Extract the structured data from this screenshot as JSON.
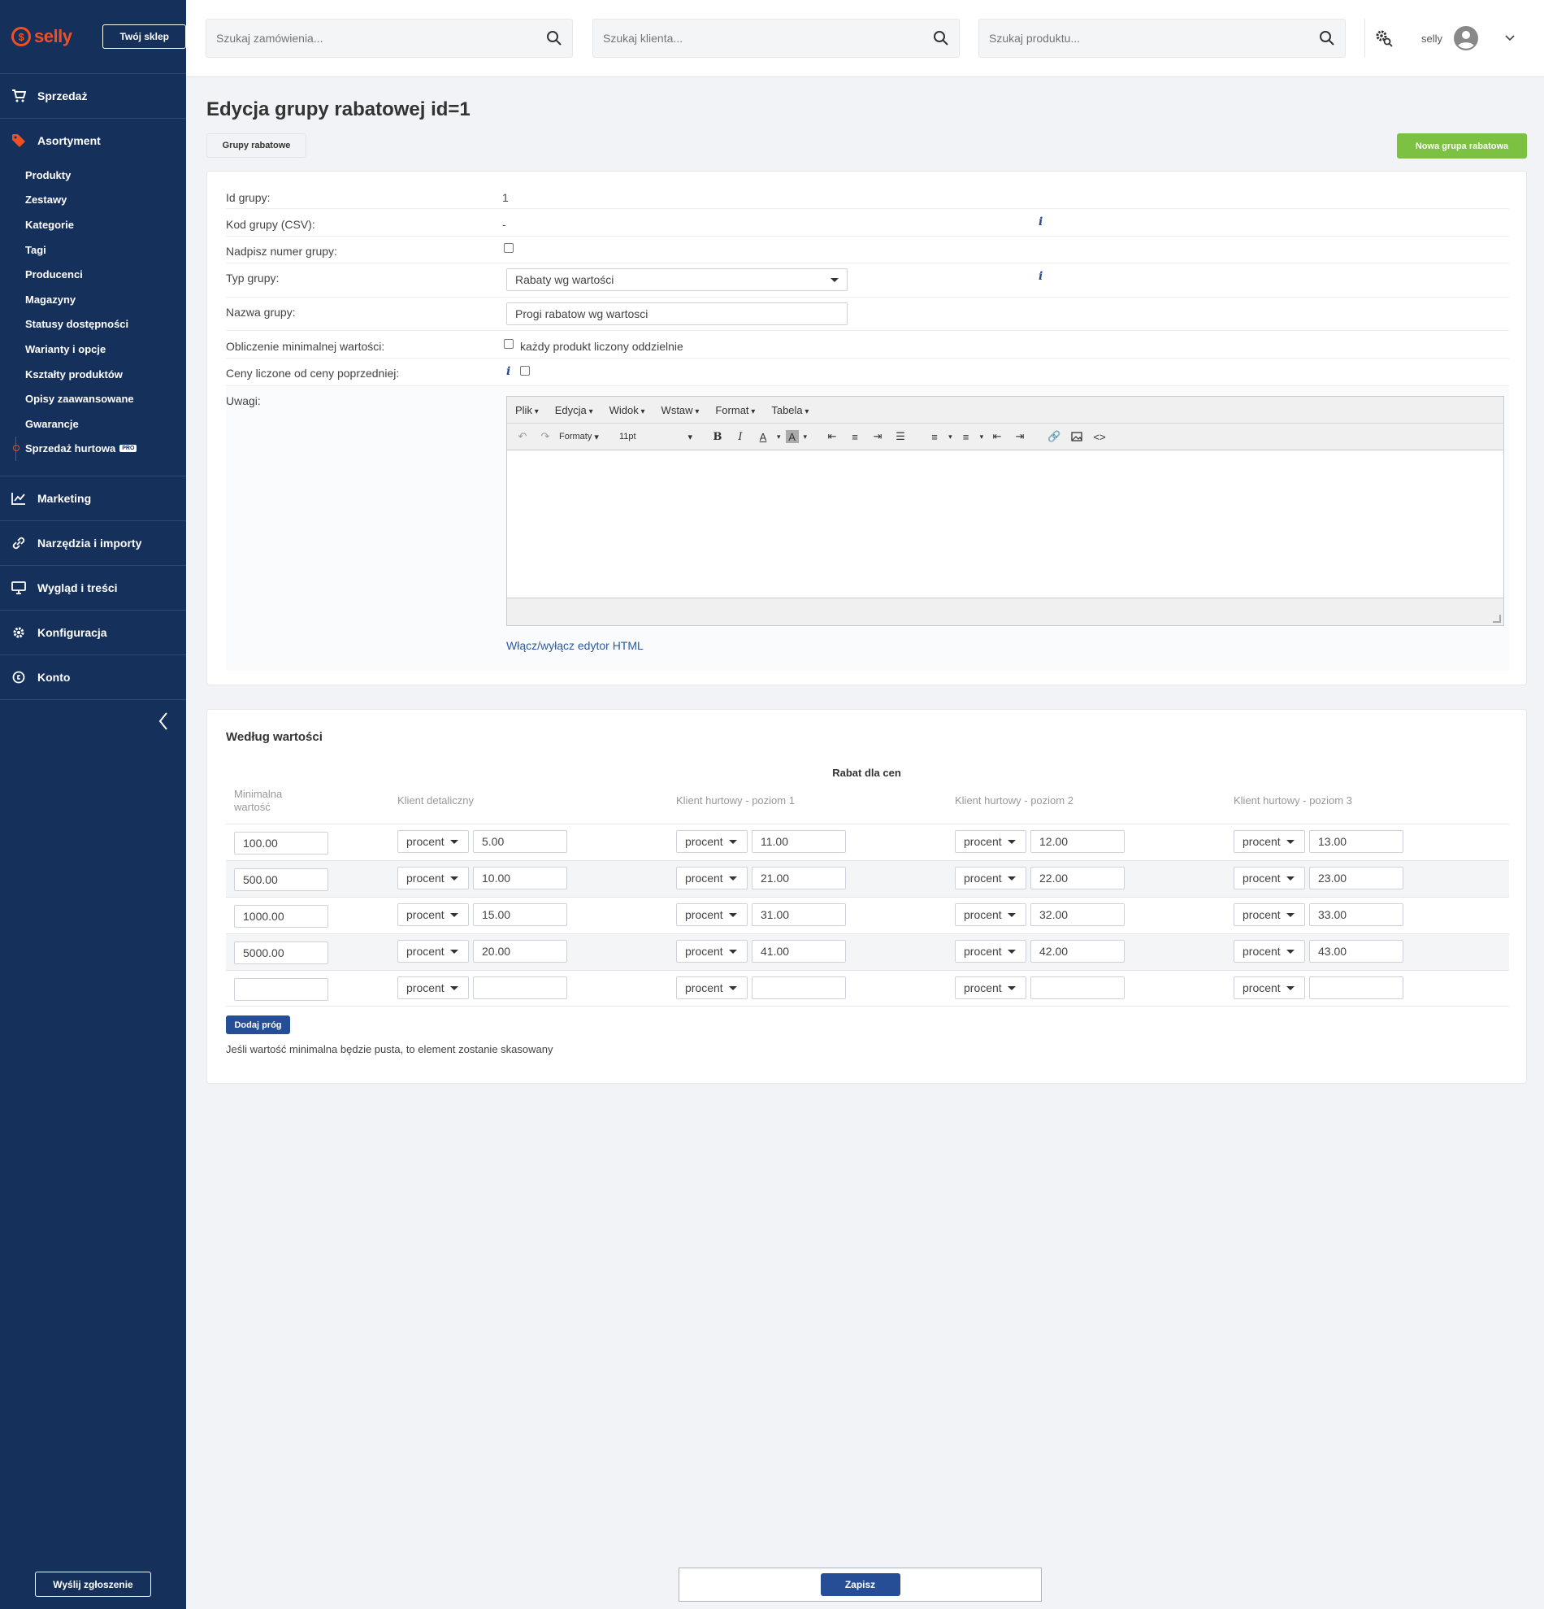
{
  "brand": {
    "logo_text": "selly",
    "shop_button": "Twój sklep"
  },
  "sidebar": {
    "sections": [
      {
        "label": "Sprzedaż",
        "icon": "cart-icon"
      },
      {
        "label": "Asortyment",
        "icon": "tag-icon"
      },
      {
        "label": "Marketing",
        "icon": "chart-icon"
      },
      {
        "label": "Narzędzia i importy",
        "icon": "link-icon"
      },
      {
        "label": "Wygląd i treści",
        "icon": "monitor-icon"
      },
      {
        "label": "Konfiguracja",
        "icon": "gear-icon"
      },
      {
        "label": "Konto",
        "icon": "account-icon"
      }
    ],
    "sub_items": [
      "Produkty",
      "Zestawy",
      "Kategorie",
      "Tagi",
      "Producenci",
      "Magazyny",
      "Statusy dostępności",
      "Warianty i opcje",
      "Kształty produktów",
      "Opisy zaawansowane",
      "Gwarancje",
      "Sprzedaż hurtowa"
    ],
    "pro_badge": "PRO",
    "report_button": "Wyślij zgłoszenie"
  },
  "topbar": {
    "search_orders": "Szukaj zamówienia...",
    "search_clients": "Szukaj klienta...",
    "search_products": "Szukaj produktu...",
    "user_name": "selly"
  },
  "page": {
    "title": "Edycja grupy rabatowej id=1",
    "tab_label": "Grupy rabatowe",
    "new_button": "Nowa grupa rabatowa"
  },
  "form": {
    "id_label": "Id grupy:",
    "id_value": "1",
    "csv_label": "Kod grupy (CSV):",
    "csv_value": "-",
    "overwrite_label": "Nadpisz numer grupy:",
    "type_label": "Typ grupy:",
    "type_value": "Rabaty wg wartości",
    "name_label": "Nazwa grupy:",
    "name_value": "Progi rabatow wg wartosci",
    "min_calc_label": "Obliczenie minimalnej wartości:",
    "min_calc_option": "każdy produkt liczony oddzielnie",
    "prev_price_label": "Ceny liczone od ceny poprzedniej:",
    "notes_label": "Uwagi:",
    "html_toggle": "Włącz/wyłącz edytor HTML"
  },
  "editor": {
    "menus": [
      "Plik",
      "Edycja",
      "Widok",
      "Wstaw",
      "Format",
      "Tabela"
    ],
    "formats_label": "Formaty",
    "font_size": "11pt"
  },
  "thresholds": {
    "title": "Według wartości",
    "group_header": "Rabat dla cen",
    "col_min": "Minimalna wartość",
    "columns": [
      "Klient detaliczny",
      "Klient hurtowy - poziom 1",
      "Klient hurtowy - poziom 2",
      "Klient hurtowy - poziom 3"
    ],
    "type_option": "procent",
    "rows": [
      {
        "min": "100.00",
        "values": [
          "5.00",
          "11.00",
          "12.00",
          "13.00"
        ]
      },
      {
        "min": "500.00",
        "values": [
          "10.00",
          "21.00",
          "22.00",
          "23.00"
        ]
      },
      {
        "min": "1000.00",
        "values": [
          "15.00",
          "31.00",
          "32.00",
          "33.00"
        ]
      },
      {
        "min": "5000.00",
        "values": [
          "20.00",
          "41.00",
          "42.00",
          "43.00"
        ]
      },
      {
        "min": "",
        "values": [
          "",
          "",
          "",
          ""
        ]
      }
    ],
    "add_button": "Dodaj próg",
    "hint": "Jeśli wartość minimalna będzie pusta, to element zostanie skasowany"
  },
  "footer": {
    "save_button": "Zapisz"
  },
  "colors": {
    "sidebar": "#16305c",
    "accent": "#f04e23",
    "primary": "#264e96",
    "success": "#7cc142"
  }
}
